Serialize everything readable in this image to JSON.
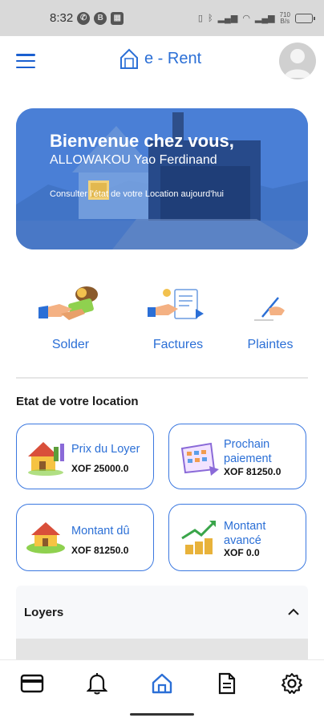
{
  "status_bar": {
    "time": "8:32",
    "net_speed_top": "710",
    "net_speed_bottom": "B/s"
  },
  "header": {
    "app_name": "e - Rent"
  },
  "hero": {
    "title": "Bienvenue chez vous,",
    "name": "ALLOWAKOU Yao Ferdinand",
    "subtitle": "Consulter l'état de votre Location aujourd'hui"
  },
  "actions": [
    {
      "label": "Solder",
      "icon": "payment-hands-icon"
    },
    {
      "label": "Factures",
      "icon": "invoice-icon"
    },
    {
      "label": "Plaintes",
      "icon": "writing-hand-icon"
    }
  ],
  "section_title": "Etat de votre location",
  "cards": {
    "rent_price": {
      "label": "Prix du Loyer",
      "value": "XOF 25000.0",
      "icon": "house-icon"
    },
    "next_payment": {
      "label": "Prochain paiement",
      "value": "XOF 81250.0",
      "icon": "calendar-icon"
    },
    "amount_due": {
      "label": "Montant dû",
      "value": "XOF 81250.0",
      "icon": "house-icon"
    },
    "amount_advanced": {
      "label": "Montant avancé",
      "value": "XOF 0.0",
      "icon": "coins-growth-icon"
    }
  },
  "accordion": {
    "title": "Loyers",
    "expanded": true
  },
  "bottom_nav": [
    {
      "name": "card",
      "icon": "credit-card-icon"
    },
    {
      "name": "notifications",
      "icon": "bell-icon"
    },
    {
      "name": "home",
      "icon": "home-icon",
      "active": true
    },
    {
      "name": "documents",
      "icon": "document-icon"
    },
    {
      "name": "settings",
      "icon": "gear-icon"
    }
  ],
  "colors": {
    "primary": "#2b6fd6",
    "card_border": "#3b78e0",
    "status_bar": "#d9d9d9"
  }
}
